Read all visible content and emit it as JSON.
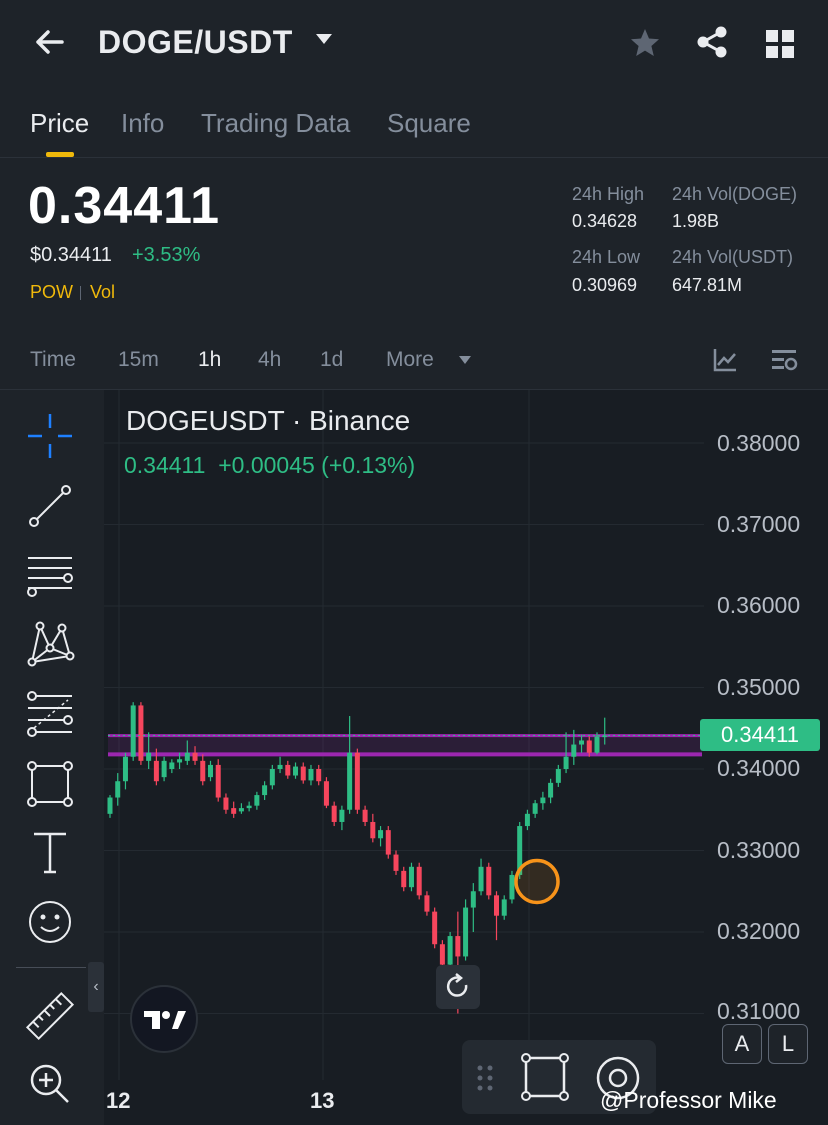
{
  "header": {
    "pair": "DOGE/USDT",
    "icons": [
      "back-arrow-icon",
      "caret-down-icon",
      "star-icon",
      "share-icon",
      "grid-icon"
    ]
  },
  "tabs": [
    {
      "label": "Price",
      "active": true
    },
    {
      "label": "Info",
      "active": false
    },
    {
      "label": "Trading Data",
      "active": false
    },
    {
      "label": "Square",
      "active": false
    }
  ],
  "ticker": {
    "last_price": "0.34411",
    "usd_price": "$0.34411",
    "change_pct": "+3.53%",
    "tag_pow": "POW",
    "tag_vol": "Vol",
    "high_label": "24h High",
    "high_value": "0.34628",
    "low_label": "24h Low",
    "low_value": "0.30969",
    "vol_doge_label": "24h Vol(DOGE)",
    "vol_doge_value": "1.98B",
    "vol_usdt_label": "24h Vol(USDT)",
    "vol_usdt_value": "647.81M"
  },
  "intervals": [
    {
      "label": "Time",
      "active": false
    },
    {
      "label": "15m",
      "active": false
    },
    {
      "label": "1h",
      "active": true
    },
    {
      "label": "4h",
      "active": false
    },
    {
      "label": "1d",
      "active": false
    },
    {
      "label": "More",
      "active": false
    }
  ],
  "tools": [
    "crosshair-icon",
    "trend-line-icon",
    "horizontal-lines-icon",
    "pattern-icon",
    "fib-icon",
    "rectangle-icon",
    "text-tool-icon",
    "emoji-icon",
    "ruler-icon",
    "zoom-in-icon"
  ],
  "chart": {
    "title": "DOGEUSDT · Binance",
    "ohlc_line": "0.34411  +0.00045 (+0.13%)",
    "current_price_tag": "0.34411",
    "y_ticks": [
      "0.38000",
      "0.37000",
      "0.36000",
      "0.35000",
      "0.34000",
      "0.33000",
      "0.32000",
      "0.31000"
    ],
    "x_ticks": [
      "12",
      "13"
    ],
    "btn_a": "A",
    "btn_l": "L",
    "up_color": "#2ebd85",
    "down_color": "#f6465d",
    "resistance_color": "#9c27b0",
    "highlight_color": "#f7931a"
  },
  "chart_data": {
    "type": "candlestick",
    "title": "DOGEUSDT · Binance",
    "interval": "1h",
    "x_ticks": [
      "12",
      "13"
    ],
    "ylim": [
      0.309,
      0.384
    ],
    "y_ticks": [
      0.38,
      0.37,
      0.36,
      0.35,
      0.34,
      0.33,
      0.32,
      0.31
    ],
    "last_price": 0.34411,
    "resistance_band": [
      0.3418,
      0.3441
    ],
    "highlight_circle_price": 0.3262,
    "candles": [
      {
        "o": 0.3345,
        "h": 0.3368,
        "l": 0.334,
        "c": 0.3365
      },
      {
        "o": 0.3365,
        "h": 0.3395,
        "l": 0.3355,
        "c": 0.3385
      },
      {
        "o": 0.3385,
        "h": 0.342,
        "l": 0.3375,
        "c": 0.3415
      },
      {
        "o": 0.3415,
        "h": 0.3482,
        "l": 0.341,
        "c": 0.3478
      },
      {
        "o": 0.3478,
        "h": 0.3482,
        "l": 0.3405,
        "c": 0.341
      },
      {
        "o": 0.341,
        "h": 0.3445,
        "l": 0.34,
        "c": 0.342
      },
      {
        "o": 0.341,
        "h": 0.3425,
        "l": 0.338,
        "c": 0.3385
      },
      {
        "o": 0.339,
        "h": 0.3415,
        "l": 0.3385,
        "c": 0.341
      },
      {
        "o": 0.34,
        "h": 0.3412,
        "l": 0.3395,
        "c": 0.3408
      },
      {
        "o": 0.3408,
        "h": 0.342,
        "l": 0.34,
        "c": 0.3412
      },
      {
        "o": 0.341,
        "h": 0.3435,
        "l": 0.3405,
        "c": 0.342
      },
      {
        "o": 0.342,
        "h": 0.3428,
        "l": 0.3405,
        "c": 0.341
      },
      {
        "o": 0.341,
        "h": 0.3418,
        "l": 0.338,
        "c": 0.3385
      },
      {
        "o": 0.339,
        "h": 0.341,
        "l": 0.3385,
        "c": 0.3405
      },
      {
        "o": 0.3405,
        "h": 0.3412,
        "l": 0.336,
        "c": 0.3365
      },
      {
        "o": 0.3365,
        "h": 0.337,
        "l": 0.3345,
        "c": 0.335
      },
      {
        "o": 0.3352,
        "h": 0.336,
        "l": 0.334,
        "c": 0.3345
      },
      {
        "o": 0.3348,
        "h": 0.3358,
        "l": 0.3345,
        "c": 0.3352
      },
      {
        "o": 0.3352,
        "h": 0.336,
        "l": 0.3348,
        "c": 0.3355
      },
      {
        "o": 0.3355,
        "h": 0.3372,
        "l": 0.335,
        "c": 0.3368
      },
      {
        "o": 0.3368,
        "h": 0.3385,
        "l": 0.3362,
        "c": 0.338
      },
      {
        "o": 0.338,
        "h": 0.3405,
        "l": 0.3375,
        "c": 0.34
      },
      {
        "o": 0.34,
        "h": 0.3415,
        "l": 0.3395,
        "c": 0.3405
      },
      {
        "o": 0.3405,
        "h": 0.341,
        "l": 0.3388,
        "c": 0.3392
      },
      {
        "o": 0.3392,
        "h": 0.3408,
        "l": 0.3388,
        "c": 0.3403
      },
      {
        "o": 0.3403,
        "h": 0.3408,
        "l": 0.3382,
        "c": 0.3386
      },
      {
        "o": 0.3386,
        "h": 0.3405,
        "l": 0.338,
        "c": 0.34
      },
      {
        "o": 0.34,
        "h": 0.3405,
        "l": 0.338,
        "c": 0.3385
      },
      {
        "o": 0.3385,
        "h": 0.339,
        "l": 0.3352,
        "c": 0.3355
      },
      {
        "o": 0.3355,
        "h": 0.336,
        "l": 0.333,
        "c": 0.3335
      },
      {
        "o": 0.3335,
        "h": 0.3355,
        "l": 0.3325,
        "c": 0.335
      },
      {
        "o": 0.335,
        "h": 0.3465,
        "l": 0.3345,
        "c": 0.342
      },
      {
        "o": 0.342,
        "h": 0.3425,
        "l": 0.3345,
        "c": 0.335
      },
      {
        "o": 0.335,
        "h": 0.3355,
        "l": 0.333,
        "c": 0.3335
      },
      {
        "o": 0.3335,
        "h": 0.3345,
        "l": 0.331,
        "c": 0.3315
      },
      {
        "o": 0.3315,
        "h": 0.333,
        "l": 0.3305,
        "c": 0.3325
      },
      {
        "o": 0.3325,
        "h": 0.333,
        "l": 0.329,
        "c": 0.3295
      },
      {
        "o": 0.3295,
        "h": 0.33,
        "l": 0.327,
        "c": 0.3275
      },
      {
        "o": 0.3275,
        "h": 0.328,
        "l": 0.325,
        "c": 0.3255
      },
      {
        "o": 0.3255,
        "h": 0.3285,
        "l": 0.325,
        "c": 0.328
      },
      {
        "o": 0.328,
        "h": 0.3285,
        "l": 0.324,
        "c": 0.3245
      },
      {
        "o": 0.3245,
        "h": 0.325,
        "l": 0.322,
        "c": 0.3225
      },
      {
        "o": 0.3225,
        "h": 0.323,
        "l": 0.318,
        "c": 0.3185
      },
      {
        "o": 0.3185,
        "h": 0.319,
        "l": 0.3155,
        "c": 0.316
      },
      {
        "o": 0.316,
        "h": 0.32,
        "l": 0.3155,
        "c": 0.3195
      },
      {
        "o": 0.3195,
        "h": 0.3225,
        "l": 0.31,
        "c": 0.317
      },
      {
        "o": 0.317,
        "h": 0.324,
        "l": 0.3165,
        "c": 0.323
      },
      {
        "o": 0.323,
        "h": 0.326,
        "l": 0.32,
        "c": 0.325
      },
      {
        "o": 0.325,
        "h": 0.329,
        "l": 0.3245,
        "c": 0.328
      },
      {
        "o": 0.328,
        "h": 0.3285,
        "l": 0.324,
        "c": 0.3245
      },
      {
        "o": 0.3245,
        "h": 0.325,
        "l": 0.319,
        "c": 0.322
      },
      {
        "o": 0.322,
        "h": 0.3245,
        "l": 0.3215,
        "c": 0.324
      },
      {
        "o": 0.324,
        "h": 0.3275,
        "l": 0.3235,
        "c": 0.327
      },
      {
        "o": 0.327,
        "h": 0.3335,
        "l": 0.3265,
        "c": 0.333
      },
      {
        "o": 0.333,
        "h": 0.335,
        "l": 0.3325,
        "c": 0.3345
      },
      {
        "o": 0.3345,
        "h": 0.3362,
        "l": 0.334,
        "c": 0.3358
      },
      {
        "o": 0.3358,
        "h": 0.3372,
        "l": 0.335,
        "c": 0.3365
      },
      {
        "o": 0.3365,
        "h": 0.3388,
        "l": 0.3358,
        "c": 0.3383
      },
      {
        "o": 0.3383,
        "h": 0.3405,
        "l": 0.3378,
        "c": 0.34
      },
      {
        "o": 0.34,
        "h": 0.3445,
        "l": 0.3395,
        "c": 0.3415
      },
      {
        "o": 0.3415,
        "h": 0.3448,
        "l": 0.3405,
        "c": 0.343
      },
      {
        "o": 0.343,
        "h": 0.3442,
        "l": 0.342,
        "c": 0.3435
      },
      {
        "o": 0.3435,
        "h": 0.344,
        "l": 0.3415,
        "c": 0.342
      },
      {
        "o": 0.342,
        "h": 0.3445,
        "l": 0.3418,
        "c": 0.344
      },
      {
        "o": 0.344,
        "h": 0.3463,
        "l": 0.343,
        "c": 0.3441
      }
    ]
  },
  "float_toolbar": [
    "drag-handle-icon",
    "rectangle-select-icon",
    "object-tree-icon"
  ],
  "watermark": "@Professor Mike"
}
